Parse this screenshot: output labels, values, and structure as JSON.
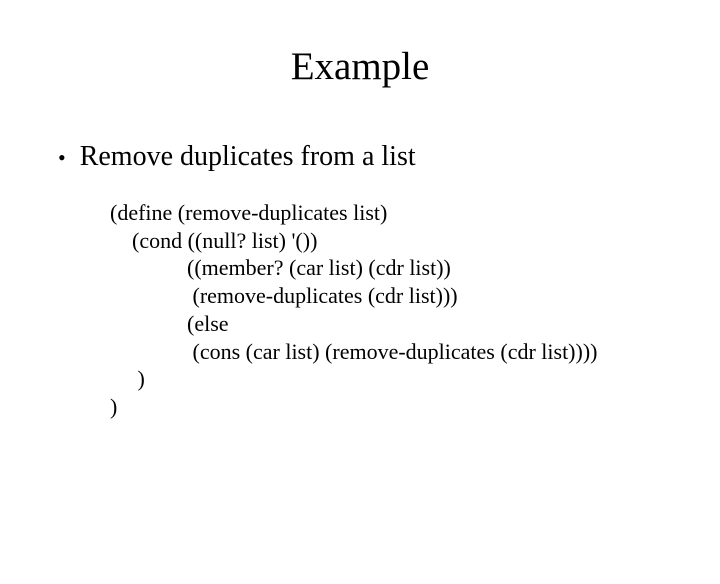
{
  "title": "Example",
  "bullet": {
    "marker": "•",
    "text": "Remove duplicates from a list"
  },
  "code": "(define (remove-duplicates list)\n    (cond ((null? list) '())\n              ((member? (car list) (cdr list))\n               (remove-duplicates (cdr list)))\n              (else\n               (cons (car list) (remove-duplicates (cdr list))))\n     )\n)"
}
